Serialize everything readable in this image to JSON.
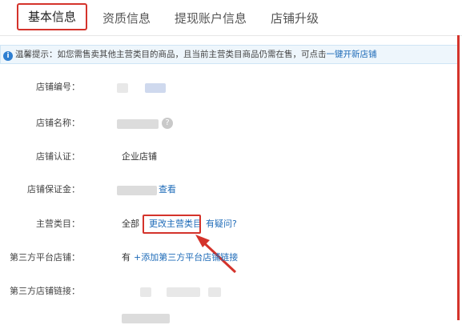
{
  "tabs": [
    {
      "label": "基本信息"
    },
    {
      "label": "资质信息"
    },
    {
      "label": "提现账户信息"
    },
    {
      "label": "店铺升级"
    }
  ],
  "tip": {
    "icon": "info-icon",
    "text": "温馨提示：如您需售卖其他主营类目的商品，且当前主营类目商品仍需在售，可点击",
    "link": "一键开新店铺"
  },
  "fields": {
    "shop_id": {
      "label": "店铺编号："
    },
    "shop_name": {
      "label": "店铺名称："
    },
    "shop_cert": {
      "label": "店铺认证：",
      "value": "企业店铺"
    },
    "shop_deposit": {
      "label": "店铺保证金：",
      "link": "查看"
    },
    "main_category": {
      "label": "主营类目：",
      "value": "全部",
      "change_link": "更改主营类目",
      "help_link": "有疑问?"
    },
    "third_party_shop": {
      "label": "第三方平台店铺：",
      "value": "有",
      "add_link": "+添加第三方平台店铺链接"
    },
    "third_party_link": {
      "label": "第三方店铺链接："
    }
  },
  "colors": {
    "highlight": "#d4332b",
    "link": "#1e6bb8",
    "tip_bg": "#eef6fc"
  }
}
